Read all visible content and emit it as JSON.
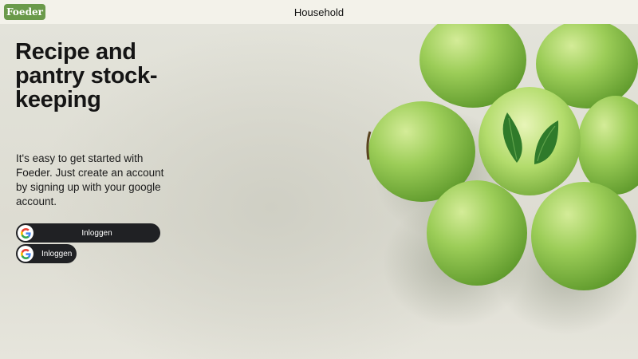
{
  "header": {
    "logo_text": "Foeder",
    "title": "Household"
  },
  "hero": {
    "headline": "Recipe and pantry stock-keeping",
    "intro": "It's easy to get started with Foeder. Just create an account by signing up with your google account."
  },
  "auth": {
    "google_button_wide_label": "Inloggen",
    "google_button_small_label": "Inloggen"
  },
  "colors": {
    "brand": "#6a9a4a",
    "button_dark": "#202124",
    "apple_green": "#8cc850"
  },
  "icons": {
    "google": "google-g-icon",
    "hero_image": "green-apples-photo"
  }
}
